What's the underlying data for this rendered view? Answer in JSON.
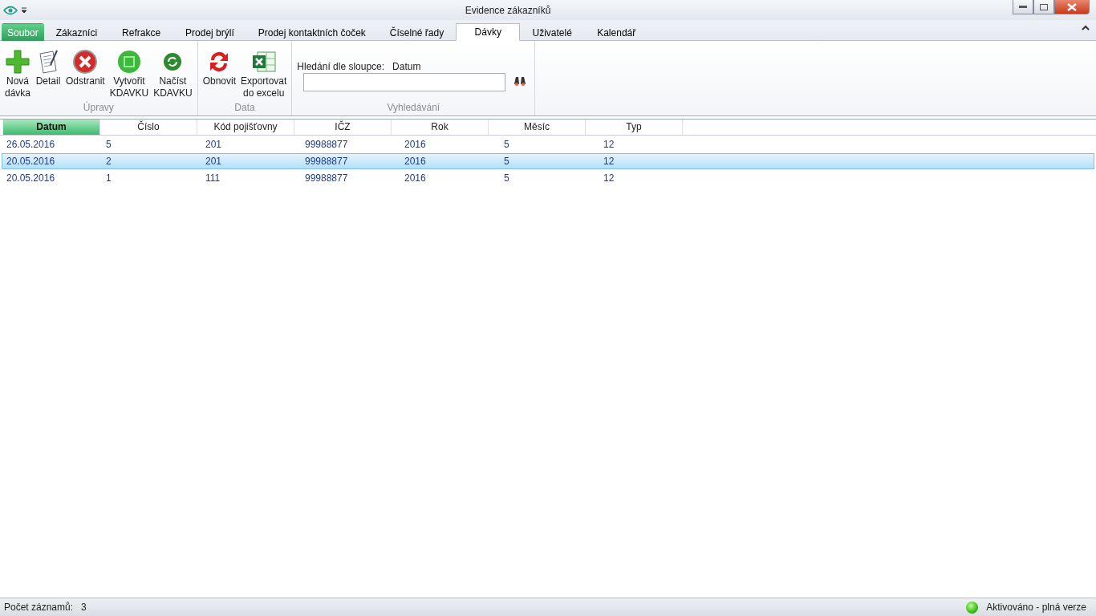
{
  "window": {
    "title": "Evidence zákazníků"
  },
  "tabs": [
    {
      "label": "Soubor",
      "kind": "file",
      "selected": false
    },
    {
      "label": "Zákazníci",
      "kind": "tab",
      "selected": false
    },
    {
      "label": "Refrakce",
      "kind": "tab",
      "selected": false
    },
    {
      "label": "Prodej brýlí",
      "kind": "tab",
      "selected": false
    },
    {
      "label": "Prodej kontaktních čoček",
      "kind": "tab",
      "selected": false
    },
    {
      "label": "Číselné řady",
      "kind": "tab",
      "selected": false
    },
    {
      "label": "Dávky",
      "kind": "tab",
      "selected": true
    },
    {
      "label": "Uživatelé",
      "kind": "tab",
      "selected": false
    },
    {
      "label": "Kalendář",
      "kind": "tab",
      "selected": false
    }
  ],
  "ribbon": {
    "groups": [
      {
        "label": "Úpravy",
        "buttons": [
          {
            "label": "Nová dávka",
            "kind": "plus"
          },
          {
            "label": "Detail",
            "kind": "document"
          },
          {
            "label": "Odstranit",
            "kind": "delete"
          },
          {
            "label": "Vytvořit KDAVKU",
            "kind": "save"
          },
          {
            "label": "Načíst KDAVKU",
            "kind": "load"
          }
        ]
      },
      {
        "label": "Data",
        "buttons": [
          {
            "label": "Obnovit",
            "kind": "refresh"
          },
          {
            "label": "Exportovat do excelu",
            "kind": "excel"
          }
        ]
      }
    ],
    "search": {
      "label": "Hledání dle sloupce:",
      "column": "Datum",
      "group_label": "Vyhledávání"
    }
  },
  "table": {
    "columns": [
      {
        "label": "Datum",
        "sorted": true
      },
      {
        "label": "Číslo",
        "sorted": false
      },
      {
        "label": "Kód pojišťovny",
        "sorted": false
      },
      {
        "label": "IČZ",
        "sorted": false
      },
      {
        "label": "Rok",
        "sorted": false
      },
      {
        "label": "Měsíc",
        "sorted": false
      },
      {
        "label": "Typ",
        "sorted": false
      }
    ],
    "rows": [
      {
        "cells": [
          "26.05.2016",
          "5",
          "201",
          "99988877",
          "2016",
          "5",
          "12"
        ],
        "selected": false
      },
      {
        "cells": [
          "20.05.2016",
          "2",
          "201",
          "99988877",
          "2016",
          "5",
          "12"
        ],
        "selected": true
      },
      {
        "cells": [
          "20.05.2016",
          "1",
          "111",
          "99988877",
          "2016",
          "5",
          "12"
        ],
        "selected": false
      }
    ]
  },
  "status_bar": {
    "count_label": "Počet záznamů:",
    "count": "3",
    "activation": "Aktivováno - plná verze"
  }
}
